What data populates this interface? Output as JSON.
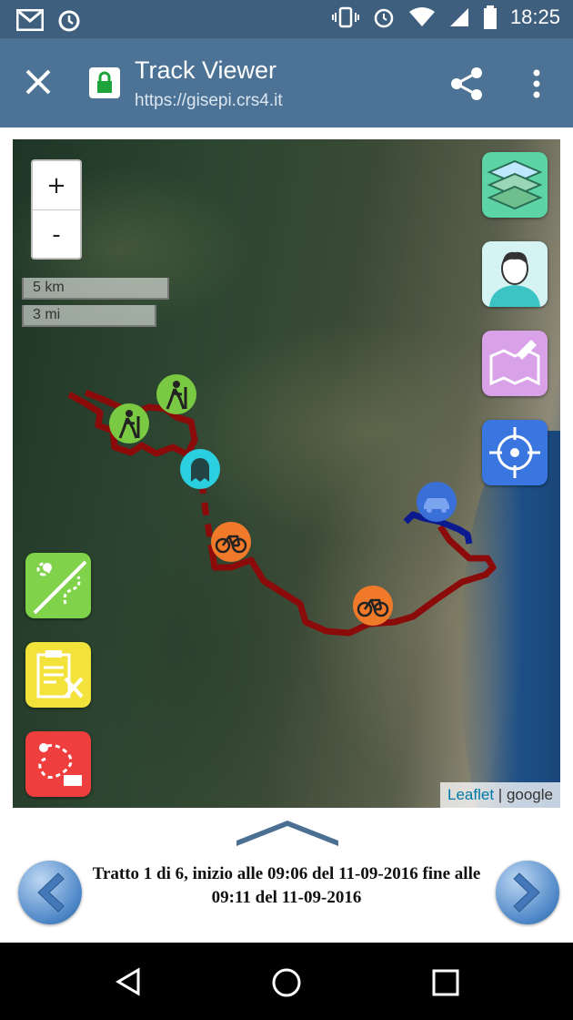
{
  "status_bar": {
    "time": "18:25"
  },
  "app_bar": {
    "title": "Track Viewer",
    "url": "https://gisepi.crs4.it"
  },
  "map": {
    "zoom_in": "+",
    "zoom_out": "-",
    "scale_km": "5 km",
    "scale_mi": "3 mi",
    "attribution_leaflet": "Leaflet",
    "attribution_sep": " | ",
    "attribution_source": "google",
    "route_color": "#8b0a0a",
    "car_route_color": "#0c1a8f"
  },
  "footer": {
    "segment_info": "Tratto 1 di 6, inizio alle 09:06 del 11-09-2016 fine alle 09:11 del 11-09-2016"
  }
}
